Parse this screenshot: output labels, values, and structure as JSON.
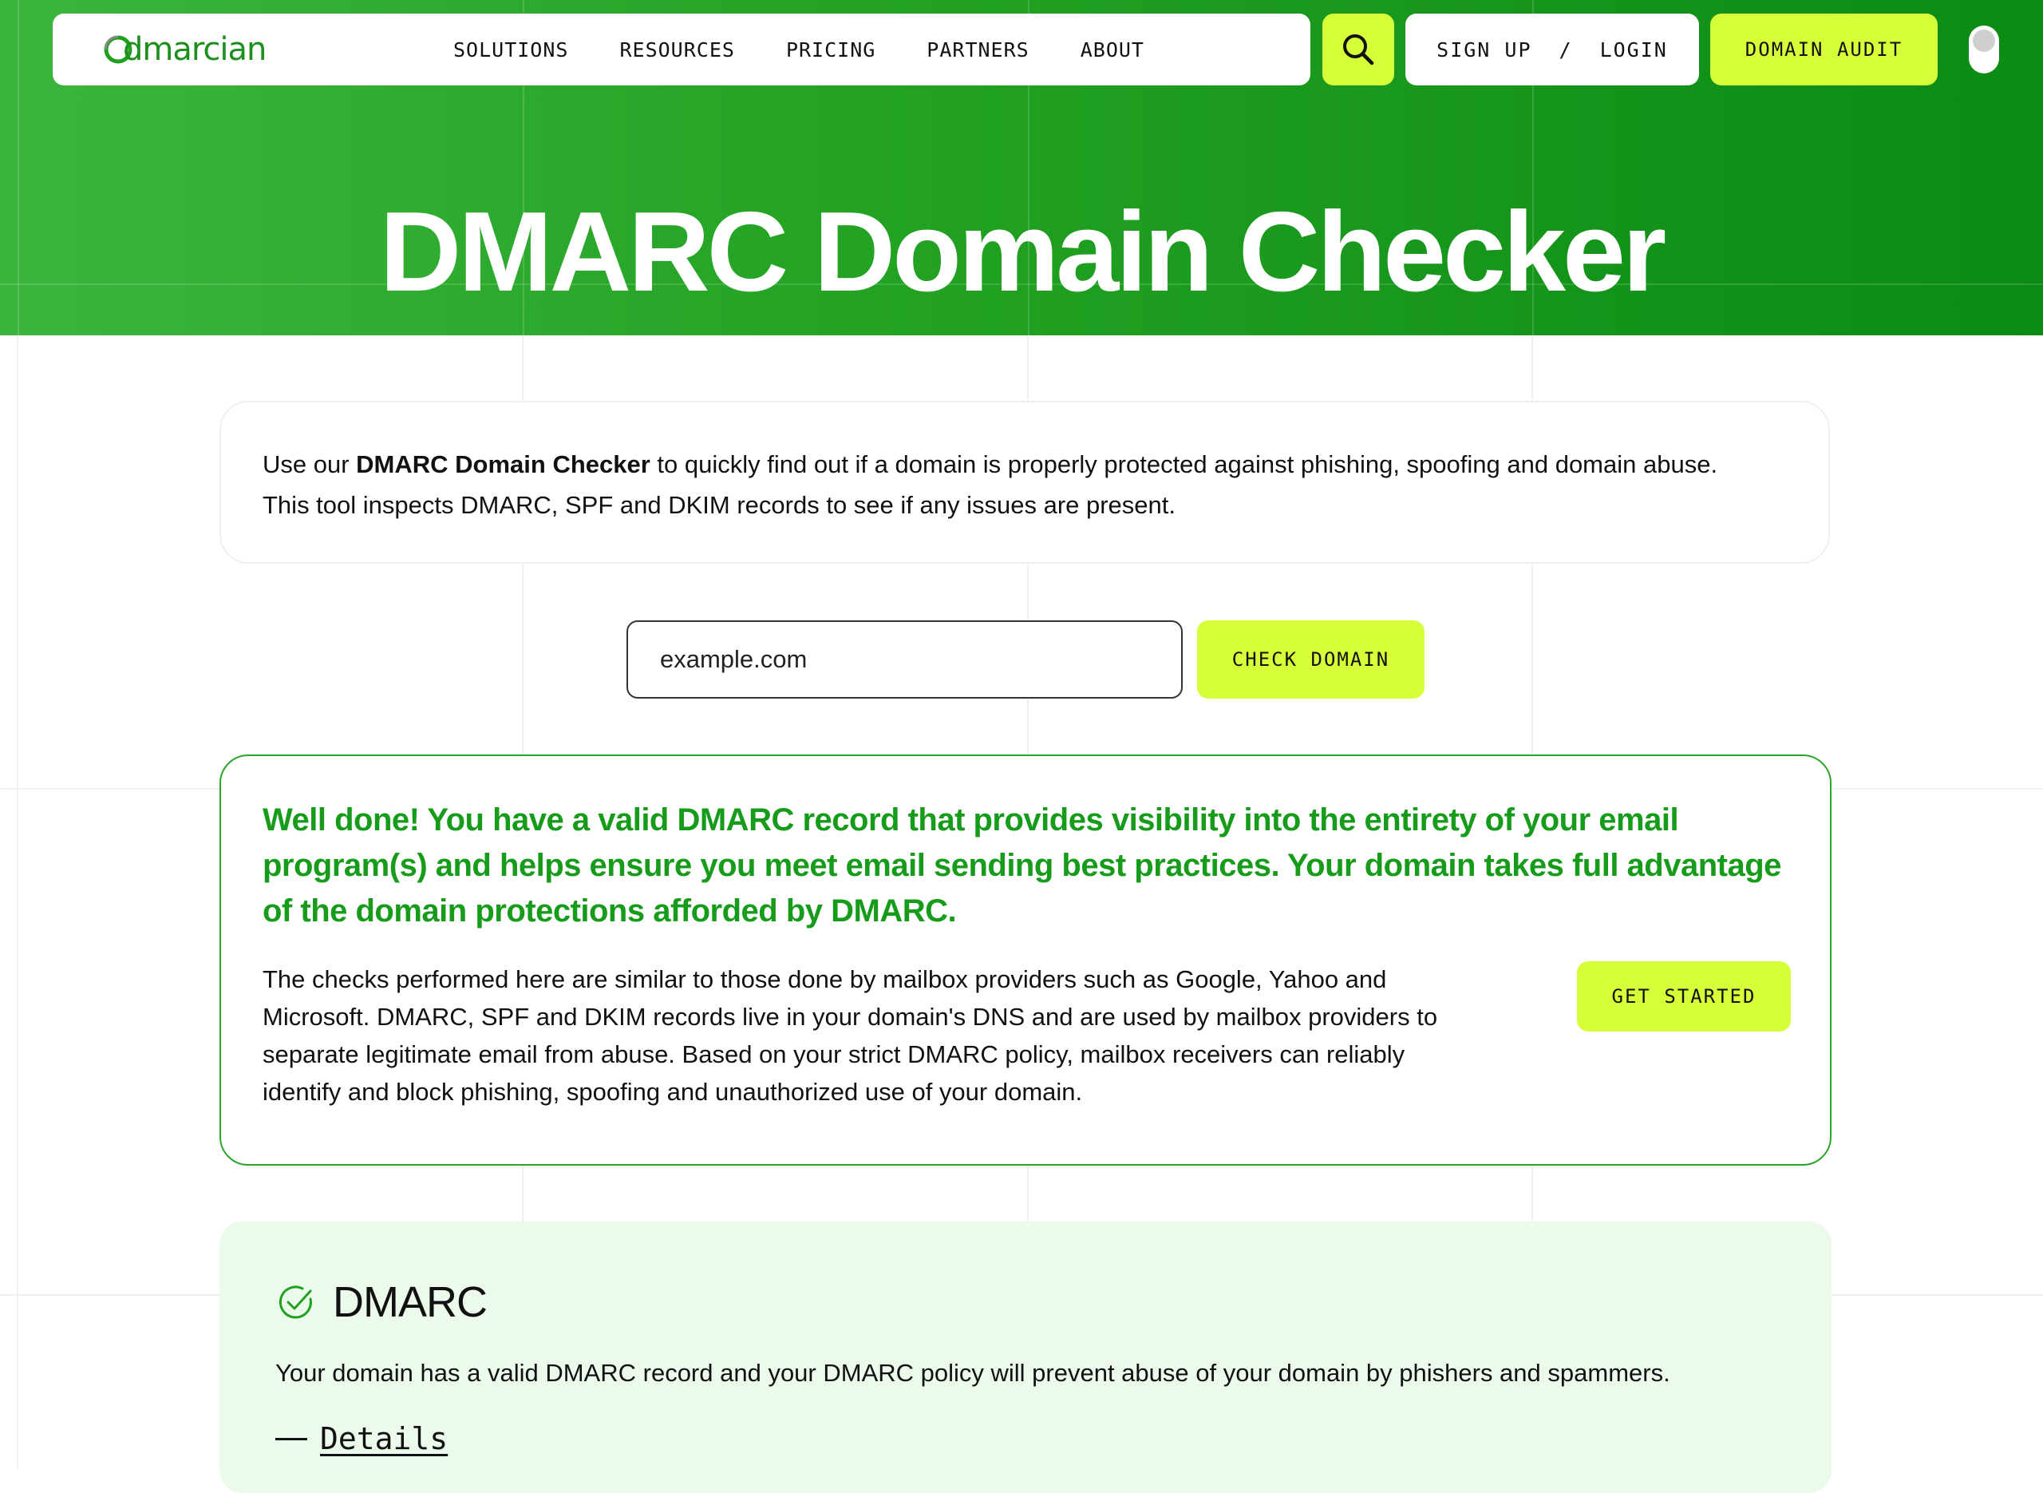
{
  "colors": {
    "brand_green": "#22a122",
    "accent_lime": "#d6ff3a",
    "success_text": "#169c1a",
    "panel_tint": "#ebfaeb"
  },
  "header": {
    "logo_text": "dmarcian",
    "nav": [
      "SOLUTIONS",
      "RESOURCES",
      "PRICING",
      "PARTNERS",
      "ABOUT"
    ],
    "search_icon": "search-icon",
    "signup_label": "SIGN UP",
    "auth_separator": "/",
    "login_label": "LOGIN",
    "audit_label": "DOMAIN AUDIT",
    "toggle_icon": "theme-toggle"
  },
  "hero": {
    "title": "DMARC Domain Checker"
  },
  "intro": {
    "prefix": "Use our ",
    "bold": "DMARC Domain Checker",
    "suffix": " to quickly find out if a domain is properly protected against phishing, spoofing and domain abuse.",
    "line2": "This tool inspects DMARC, SPF and DKIM records to see if any issues are present."
  },
  "search": {
    "value": "example.com",
    "button_label": "CHECK DOMAIN"
  },
  "result": {
    "heading": "Well done! You have a valid DMARC record that provides visibility into the entirety of your email program(s) and helps ensure you meet email sending best practices. Your domain takes full advantage of the domain protections afforded by DMARC.",
    "body": "The checks performed here are similar to those done by mailbox providers such as Google, Yahoo and Microsoft. DMARC, SPF and DKIM records live in your domain's DNS and are used by mailbox providers to separate legitimate email from abuse. Based on your strict DMARC policy, mailbox receivers can reliably identify and block phishing, spoofing and unauthorized use of your domain.",
    "button_label": "GET STARTED"
  },
  "dmarc_section": {
    "status_icon": "check-circle-icon",
    "title": "DMARC",
    "description": "Your domain has a valid DMARC record and your DMARC policy will prevent abuse of your domain by phishers and spammers.",
    "details_label": "Details"
  }
}
